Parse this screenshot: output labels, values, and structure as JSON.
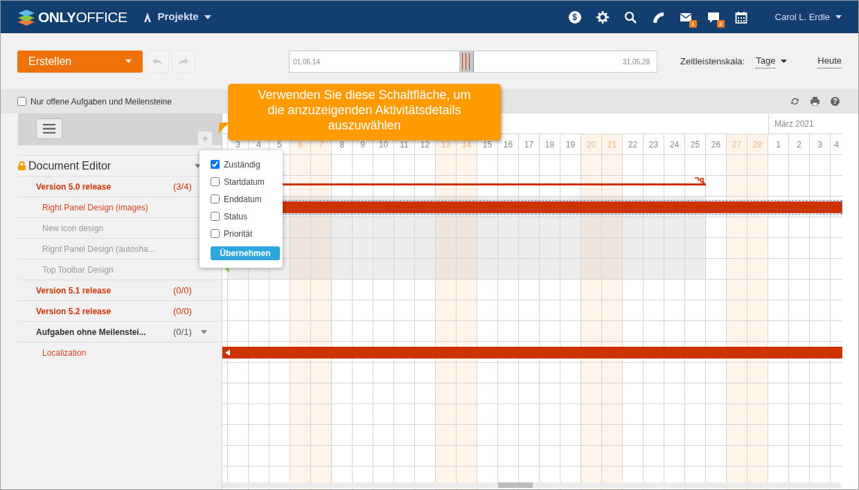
{
  "navbar": {
    "logo": "**ONLY**OFFICE",
    "module": "Projekte",
    "icons": [
      {
        "kind": "dollar",
        "glyph": "$"
      },
      {
        "kind": "settings"
      },
      {
        "kind": "search"
      },
      {
        "kind": "feed"
      },
      {
        "kind": "mail",
        "badge": "1"
      },
      {
        "kind": "chat",
        "badge": "2"
      },
      {
        "kind": "calendar"
      }
    ],
    "user": "Carol L. Erdle"
  },
  "toolbar": {
    "create_button": "Erstellen",
    "undo_disabled": true,
    "redo_disabled": true,
    "timeline": {
      "start": "01.06.14",
      "end": "31.05.28",
      "level": 0.48
    },
    "scale_label": "Zeitleistenskala:",
    "scale_value": "Tage",
    "today": "Heute"
  },
  "help_glyph": "?",
  "filter": {
    "label": "Nur offene Aufgaben und Meilensteine",
    "checked": false
  },
  "tooltip": "Verwenden Sie diese Schaltfläche, um die anzuzeigenden Aktivitätsdetails auszuwählen",
  "columns_popup": {
    "options": [
      {
        "label": "Zuständig",
        "checked": true
      },
      {
        "label": "Startdatum",
        "checked": false
      },
      {
        "label": "Enddatum",
        "checked": false
      },
      {
        "label": "Status",
        "checked": false
      },
      {
        "label": "Priorität",
        "checked": false
      }
    ],
    "apply": "Übernehmen"
  },
  "days": [
    {
      "label": "3",
      "weekend": false
    },
    {
      "label": "4",
      "weekend": false
    },
    {
      "label": "5",
      "weekend": false
    },
    {
      "label": "6",
      "weekend": true
    },
    {
      "label": "7",
      "weekend": true
    },
    {
      "label": "8",
      "weekend": false
    },
    {
      "label": "9",
      "weekend": false
    },
    {
      "label": "10",
      "weekend": false
    },
    {
      "label": "11",
      "weekend": false
    },
    {
      "label": "12",
      "weekend": false
    },
    {
      "label": "13",
      "weekend": true
    },
    {
      "label": "14",
      "weekend": true
    },
    {
      "label": "15",
      "weekend": false
    },
    {
      "label": "16",
      "weekend": false
    },
    {
      "label": "17",
      "weekend": false
    },
    {
      "label": "18",
      "weekend": false
    },
    {
      "label": "19",
      "weekend": false
    },
    {
      "label": "20",
      "weekend": true
    },
    {
      "label": "21",
      "weekend": true
    },
    {
      "label": "22",
      "weekend": false
    },
    {
      "label": "23",
      "weekend": false
    },
    {
      "label": "24",
      "weekend": false
    },
    {
      "label": "25",
      "weekend": false
    },
    {
      "label": "26",
      "weekend": false
    },
    {
      "label": "27",
      "weekend": true
    },
    {
      "label": "28",
      "weekend": true
    },
    {
      "label": "1",
      "weekend": false,
      "month_label": "März 2021"
    },
    {
      "label": "2",
      "weekend": false
    },
    {
      "label": "3",
      "weekend": false
    },
    {
      "label": "4",
      "weekend": false
    }
  ],
  "project": {
    "name": "Document Editor",
    "locked": true,
    "expanded": true,
    "children": [
      {
        "kind": "milestone",
        "name": "Version 5.0 release",
        "count": "(3/4)",
        "expanded": true,
        "children": [
          {
            "kind": "task",
            "name": "Right Panel Design (images)",
            "closed": false,
            "selected": true,
            "starts_earlier": false
          },
          {
            "kind": "task",
            "name": "New icon design",
            "closed": true,
            "selected": false,
            "starts_earlier": false
          },
          {
            "kind": "task",
            "name": "Rignt Panel Design (autosha...",
            "closed": true,
            "selected": false,
            "starts_earlier": false
          },
          {
            "kind": "task",
            "name": "Top Toolbar Design",
            "closed": true,
            "selected": false,
            "starts_earlier": true
          }
        ]
      },
      {
        "kind": "milestone",
        "name": "Version 5.1 release",
        "count": "(0/0)",
        "expanded": false
      },
      {
        "kind": "milestone",
        "name": "Version 5.2 release",
        "count": "(0/0)",
        "expanded": false
      },
      {
        "kind": "group",
        "name": "Aufgaben ohne Meilenstei...",
        "count": "(0/1)",
        "expanded": true,
        "children": [
          {
            "kind": "task",
            "name": "Localization",
            "closed": false,
            "selected": false,
            "starts_earlier": false
          }
        ]
      }
    ]
  }
}
